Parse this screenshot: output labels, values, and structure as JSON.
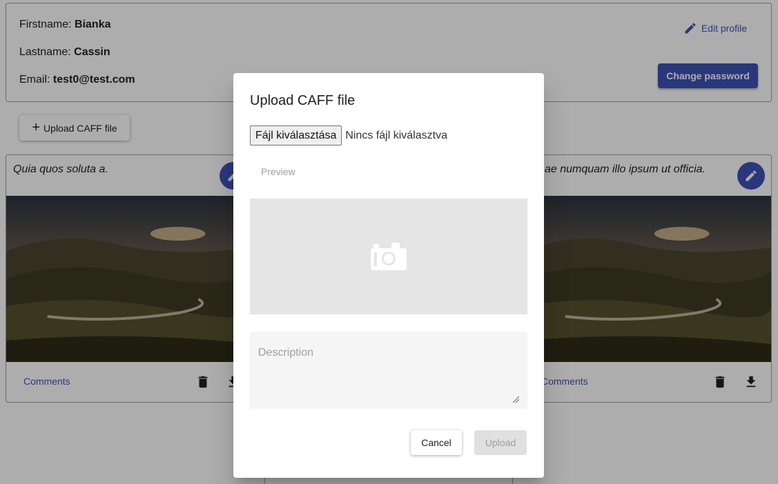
{
  "profile": {
    "firstname_label": "Firstname:",
    "firstname_value": "Bianka",
    "lastname_label": "Lastname:",
    "lastname_value": "Cassin",
    "email_label": "Email:",
    "email_value": "test0@test.com",
    "edit_profile_label": "Edit profile",
    "change_password_label": "Change password"
  },
  "toolbar": {
    "upload_icon": "plus-icon",
    "upload_label": "Upload CAFF file"
  },
  "cards": [
    {
      "description": "Quia quos soluta a.",
      "comments_label": "Comments"
    },
    {
      "description": "ae numquam illo ipsum ut officia.",
      "comments_label": "Comments"
    }
  ],
  "dialog": {
    "title": "Upload CAFF file",
    "file_button_label": "Fájl kiválasztása",
    "file_status": "Nincs fájl kiválasztva",
    "preview_label": "Preview",
    "description_placeholder": "Description",
    "cancel_label": "Cancel",
    "upload_label": "Upload"
  },
  "colors": {
    "primary": "#3f51b5",
    "backdrop": "rgba(0,0,0,0.32)"
  }
}
